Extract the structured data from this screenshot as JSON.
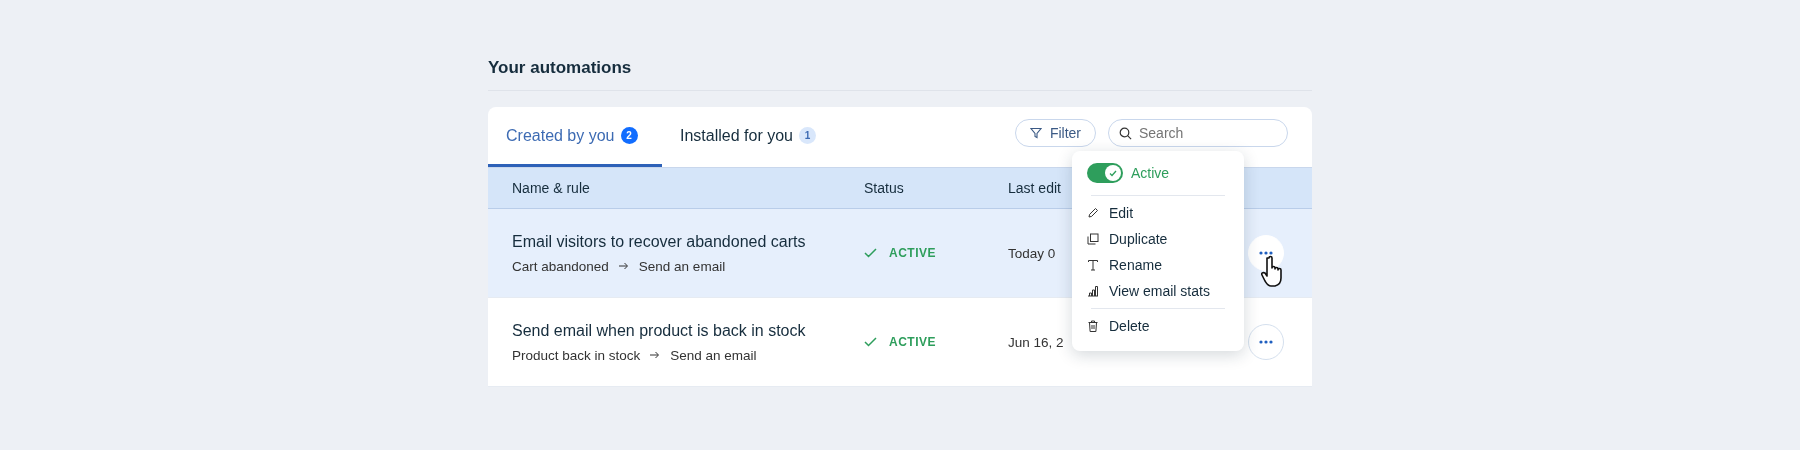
{
  "section_title": "Your automations",
  "tabs": [
    {
      "label": "Created by you",
      "count": "2",
      "selected": true
    },
    {
      "label": "Installed for you",
      "count": "1",
      "selected": false
    }
  ],
  "filter_button": {
    "label": "Filter"
  },
  "search": {
    "placeholder": "Search"
  },
  "table": {
    "columns": [
      "Name & rule",
      "Status",
      "Last edit"
    ],
    "rows": [
      {
        "name": "Email visitors to recover abandoned carts",
        "trigger": "Cart abandoned",
        "action": "Send an email",
        "status": "ACTIVE",
        "last_edited": "Today 0",
        "selected": true
      },
      {
        "name": "Send email when product is back in stock",
        "trigger": "Product back in stock",
        "action": "Send an email",
        "status": "ACTIVE",
        "last_edited": "Jun 16, 2",
        "selected": false
      }
    ]
  },
  "menu": {
    "toggle": {
      "label": "Active",
      "on": true
    },
    "groups": [
      [
        {
          "kind": "edit",
          "label": "Edit"
        },
        {
          "kind": "duplicate",
          "label": "Duplicate"
        },
        {
          "kind": "rename",
          "label": "Rename"
        },
        {
          "kind": "stats",
          "label": "View email stats"
        }
      ],
      [
        {
          "kind": "delete",
          "label": "Delete"
        }
      ]
    ]
  }
}
